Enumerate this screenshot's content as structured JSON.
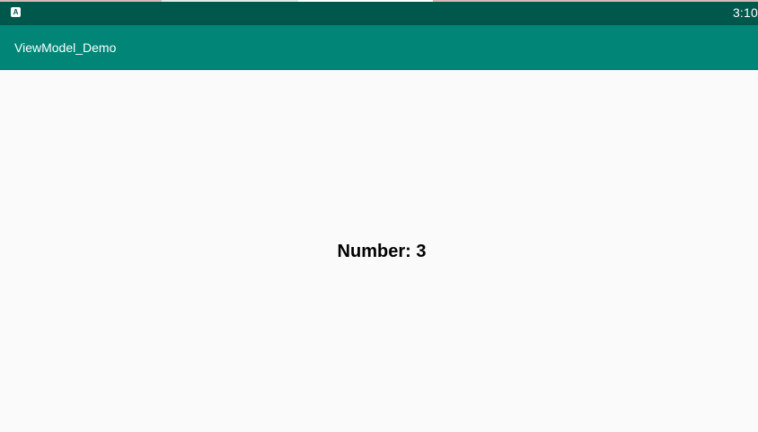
{
  "status_bar": {
    "icon": "android-notification-icon",
    "icon_glyph": "A",
    "time": "3:10",
    "color": "#00574b"
  },
  "app_bar": {
    "title": "ViewModel_Demo",
    "color": "#008577"
  },
  "main": {
    "number_text": "Number: 3"
  }
}
